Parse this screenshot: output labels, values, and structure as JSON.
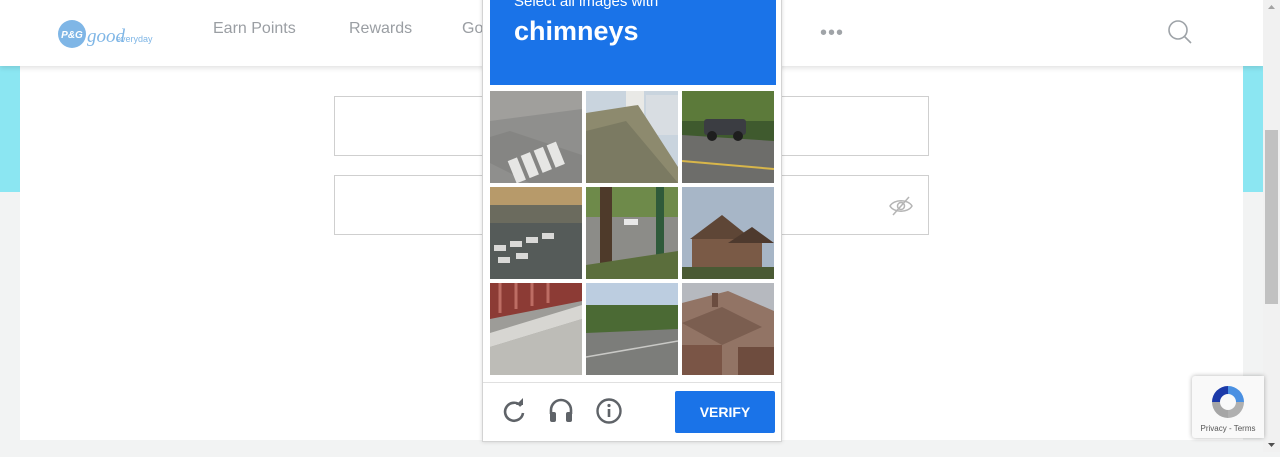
{
  "header": {
    "logo_text_pg": "P&G",
    "logo_text_good": "good",
    "logo_text_everyday": "everyday",
    "nav": [
      "Earn Points",
      "Rewards",
      "Go"
    ],
    "more": "•••"
  },
  "captcha": {
    "instruction": "Select all images with",
    "target": "chimneys",
    "verify_label": "VERIFY",
    "controls": [
      "reload-icon",
      "headphones-icon",
      "info-icon"
    ]
  },
  "recaptcha_badge": {
    "privacy": "Privacy",
    "separator": " - ",
    "terms": "Terms"
  },
  "colors": {
    "accent": "#1a73e8",
    "cyan": "#8be6f2"
  }
}
